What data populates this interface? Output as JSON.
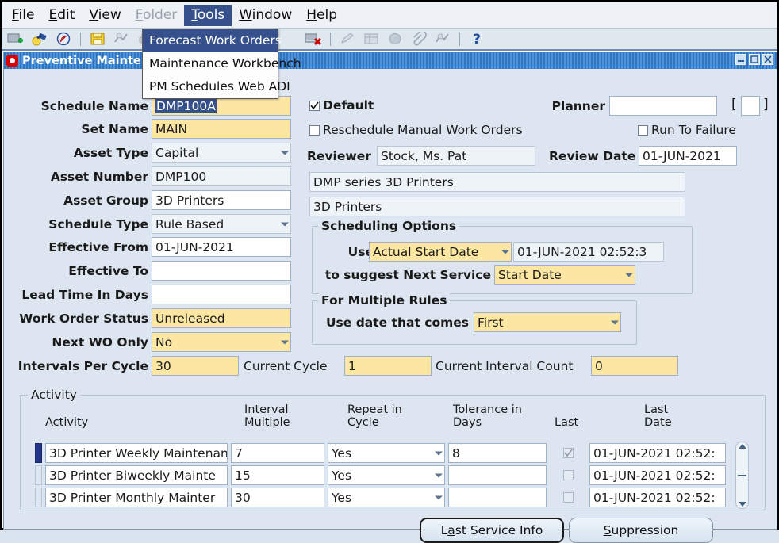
{
  "menubar": {
    "items": [
      {
        "label": "File",
        "mn": "F",
        "state": "normal"
      },
      {
        "label": "Edit",
        "mn": "E",
        "state": "normal"
      },
      {
        "label": "View",
        "mn": "V",
        "state": "normal"
      },
      {
        "label": "Folder",
        "mn": "F",
        "state": "disabled"
      },
      {
        "label": "Tools",
        "mn": "T",
        "state": "open"
      },
      {
        "label": "Window",
        "mn": "W",
        "state": "normal"
      },
      {
        "label": "Help",
        "mn": "H",
        "state": "normal"
      }
    ]
  },
  "dropdown": {
    "items": [
      {
        "label": "Forecast Work Orders",
        "selected": true
      },
      {
        "label": "Maintenance Workbench",
        "selected": false
      },
      {
        "label": "PM Schedules Web ADI",
        "selected": false
      }
    ]
  },
  "toolbar": {
    "icons": [
      "new-record-icon",
      "flashlight-find-icon",
      "show-navigator-icon",
      "separator",
      "save-icon",
      "next-step-icon",
      "print-icon",
      "separator",
      "delete-record-icon",
      "separator",
      "edit-field-icon",
      "translations-icon",
      "attachments-grey-icon",
      "attachment-clip-icon",
      "folder-tools-icon",
      "separator",
      "help-icon"
    ]
  },
  "window": {
    "title": "Preventive Maintenance Schedules",
    "controls": [
      "minimize-button",
      "maximize-button",
      "close-button"
    ]
  },
  "form": {
    "schedule_name": {
      "label": "Schedule Name",
      "value": "DMP100A",
      "required": true,
      "selected": true
    },
    "set_name": {
      "label": "Set Name",
      "value": "MAIN",
      "required": true
    },
    "asset_type": {
      "label": "Asset Type",
      "value": "Capital"
    },
    "asset_number": {
      "label": "Asset Number",
      "value": "DMP100"
    },
    "asset_group": {
      "label": "Asset Group",
      "value": "3D Printers"
    },
    "schedule_type": {
      "label": "Schedule Type",
      "value": "Rule Based"
    },
    "effective_from": {
      "label": "Effective From",
      "value": "01-JUN-2021"
    },
    "effective_to": {
      "label": "Effective To",
      "value": ""
    },
    "lead_time_in_days": {
      "label": "Lead Time In Days",
      "value": ""
    },
    "work_order_status": {
      "label": "Work Order Status",
      "value": "Unreleased",
      "required": true
    },
    "next_wo_only": {
      "label": "Next WO Only",
      "value": "No",
      "required": true
    },
    "intervals_per_cycle": {
      "label": "Intervals Per Cycle",
      "value": "30",
      "required": true
    },
    "current_cycle": {
      "label": "Current Cycle",
      "value": "1",
      "required": true
    },
    "current_interval_count": {
      "label": "Current Interval Count",
      "value": "0",
      "required": true
    },
    "default_cb": {
      "label": "Default",
      "checked": true
    },
    "reschedule_cb": {
      "label": "Reschedule Manual Work Orders",
      "checked": false
    },
    "run_to_failure_cb": {
      "label": "Run To Failure",
      "checked": false
    },
    "planner": {
      "label": "Planner",
      "value": ""
    },
    "planner_bracket_open": "[",
    "planner_bracket_close": "]",
    "reviewer": {
      "label": "Reviewer",
      "value": "Stock, Ms. Pat"
    },
    "review_date": {
      "label": "Review Date",
      "value": "01-JUN-2021"
    },
    "asset_desc": {
      "value": "DMP series 3D Printers"
    },
    "asset_group_desc": {
      "value": "3D Printers"
    }
  },
  "scheduling_options": {
    "title": "Scheduling Options",
    "use_label": "Use",
    "use_value": "Actual Start Date",
    "use_date_value": "01-JUN-2021 02:52:3",
    "suggest_label": "to suggest Next Service",
    "suggest_value": "Start Date"
  },
  "multiple_rules": {
    "title": "For Multiple Rules",
    "label": "Use date that comes",
    "value": "First"
  },
  "activity": {
    "group_title": "Activity",
    "columns": [
      {
        "name": "activity",
        "line1": "Activity",
        "line2": ""
      },
      {
        "name": "interval-multiple",
        "line1": "Interval",
        "line2": "Multiple"
      },
      {
        "name": "repeat-in-cycle",
        "line1": "Repeat in",
        "line2": "Cycle"
      },
      {
        "name": "tolerance-in-days",
        "line1": "Tolerance in",
        "line2": "Days"
      },
      {
        "name": "last",
        "line1": "Last",
        "line2": ""
      },
      {
        "name": "last-date",
        "line1": "Last",
        "line2": "Date"
      }
    ],
    "rows": [
      {
        "current": true,
        "activity": "3D Printer Weekly Maintenan",
        "interval_multiple": "7",
        "repeat_in_cycle": "Yes",
        "tolerance_in_days": "8",
        "last": true,
        "last_date": "01-JUN-2021 02:52:"
      },
      {
        "current": false,
        "activity": "3D Printer Biweekly Mainte",
        "interval_multiple": "15",
        "repeat_in_cycle": "Yes",
        "tolerance_in_days": "",
        "last": false,
        "last_date": "01-JUN-2021 02:52:"
      },
      {
        "current": false,
        "activity": "3D Printer Monthly Mainter",
        "interval_multiple": "30",
        "repeat_in_cycle": "Yes",
        "tolerance_in_days": "",
        "last": false,
        "last_date": "01-JUN-2021 02:52:"
      }
    ]
  },
  "buttons": {
    "last_service_info": {
      "label": "Last Service Info",
      "mnemonic": "a",
      "focused": true
    },
    "suppression": {
      "label": "Suppression",
      "mnemonic": "S",
      "focused": false
    }
  },
  "colors": {
    "required_field": "#fbe6a2",
    "title_bar": "#3b80cc",
    "menu_highlight": "#35508a",
    "form_bg": "#dde6f0",
    "current_row": "#26358c"
  }
}
